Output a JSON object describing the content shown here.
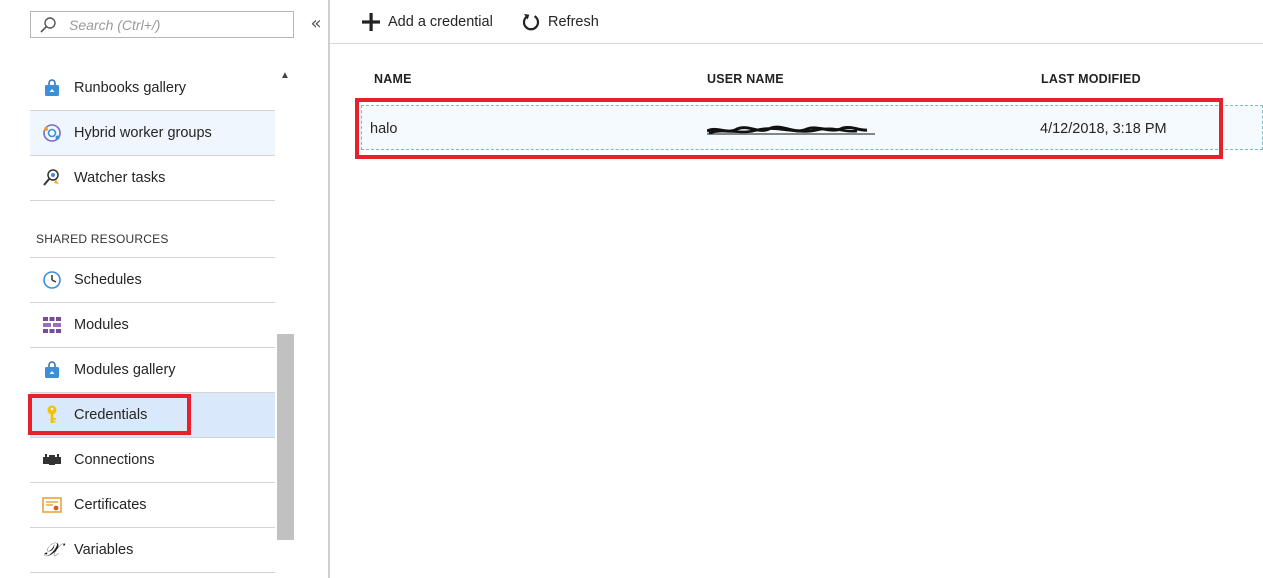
{
  "search": {
    "placeholder": "Search (Ctrl+/)"
  },
  "collapse_glyph": "«",
  "menu": {
    "items_top": [
      {
        "label": "Runbooks gallery",
        "icon": "bag-icon"
      },
      {
        "label": "Hybrid worker groups",
        "icon": "hybrid-worker-icon"
      },
      {
        "label": "Watcher tasks",
        "icon": "watcher-icon"
      }
    ],
    "section_label": "SHARED RESOURCES",
    "items_shared": [
      {
        "label": "Schedules",
        "icon": "clock-icon"
      },
      {
        "label": "Modules",
        "icon": "modules-icon"
      },
      {
        "label": "Modules gallery",
        "icon": "bag-icon"
      },
      {
        "label": "Credentials",
        "icon": "key-icon"
      },
      {
        "label": "Connections",
        "icon": "plug-icon"
      },
      {
        "label": "Certificates",
        "icon": "certificate-icon"
      },
      {
        "label": "Variables",
        "icon": "variable-x-icon"
      }
    ]
  },
  "toolbar": {
    "add_label": "Add a credential",
    "refresh_label": "Refresh"
  },
  "table": {
    "columns": [
      "NAME",
      "USER NAME",
      "LAST MODIFIED"
    ],
    "rows": [
      {
        "name": "halo",
        "user_name": "[redacted]",
        "last_modified": "4/12/2018, 3:18 PM"
      }
    ]
  },
  "colors": {
    "highlight": "#e8202b",
    "active_item_bg": "#d9e9fb",
    "hover_item_bg": "#f0f6fd"
  }
}
